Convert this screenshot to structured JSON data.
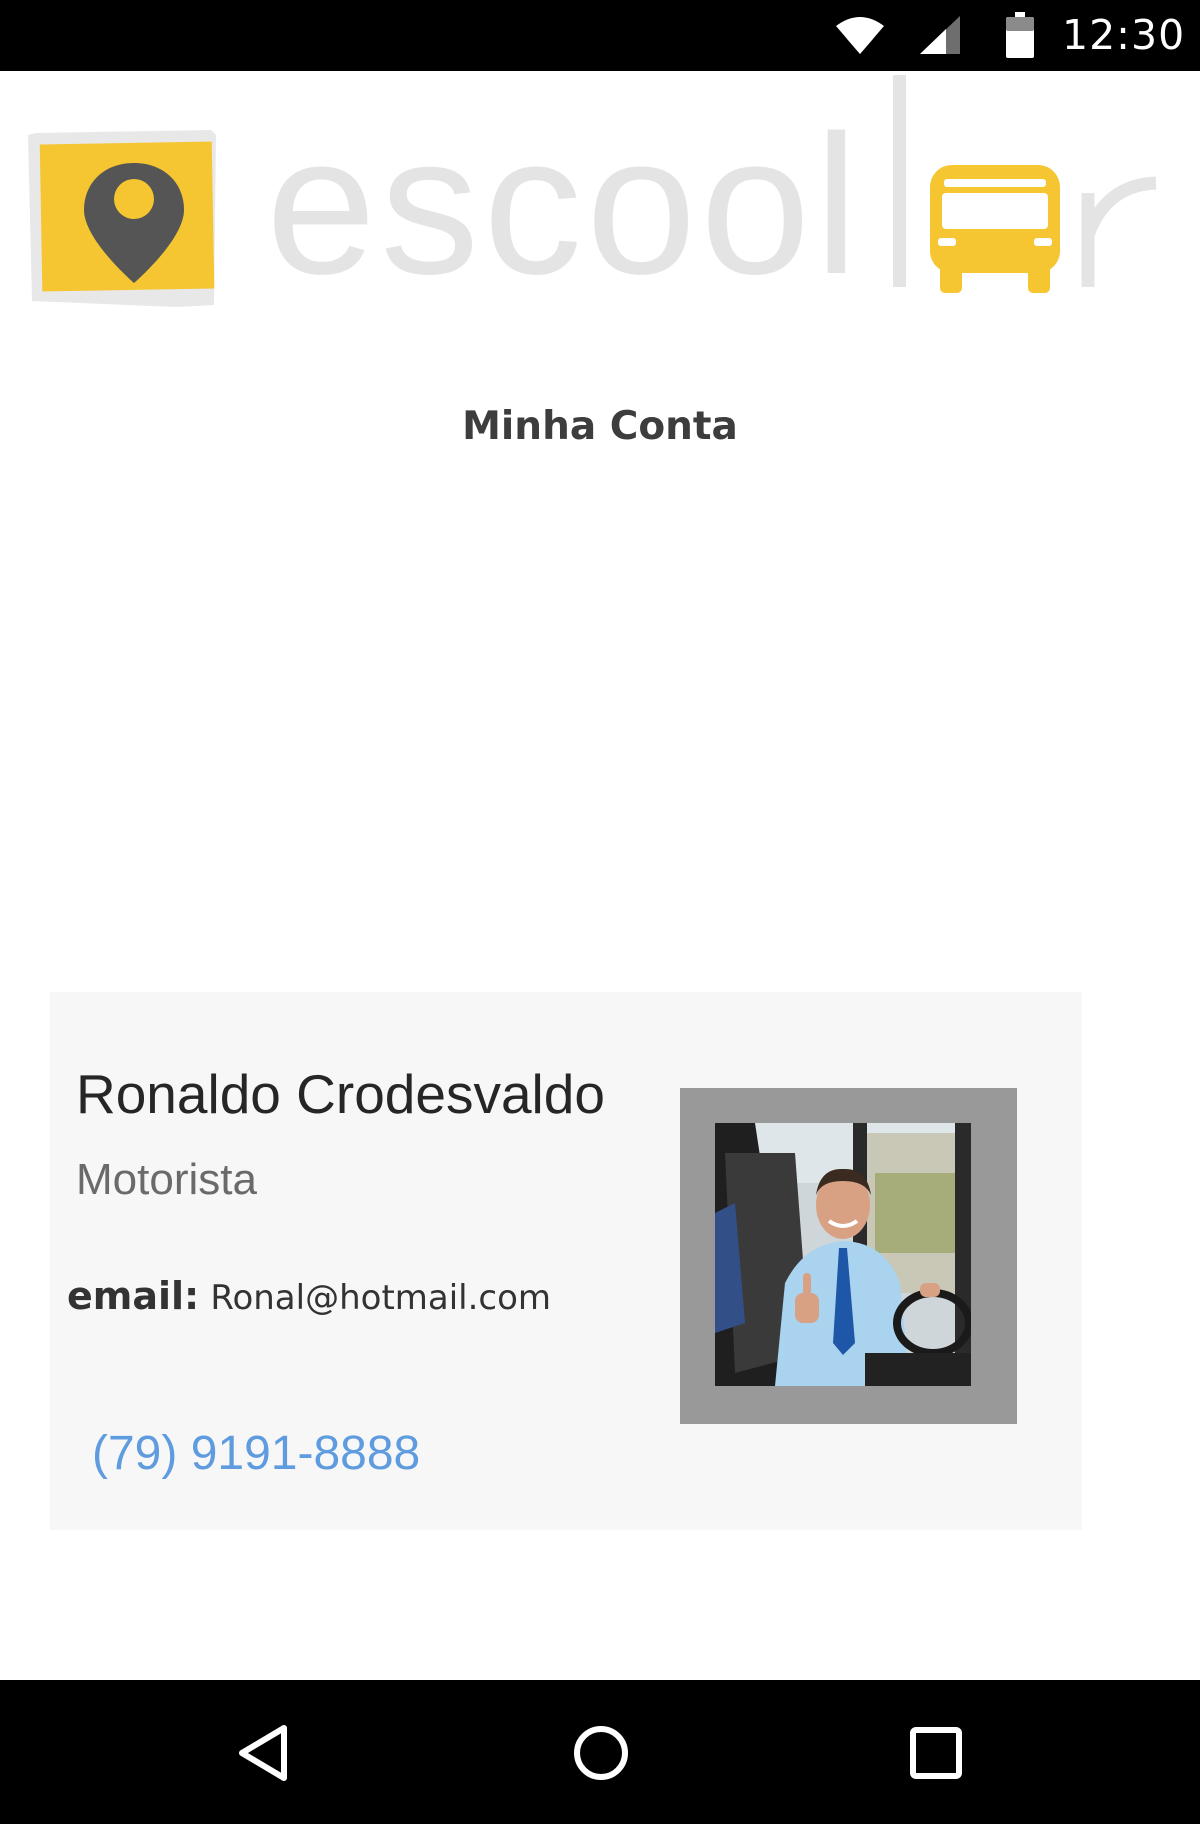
{
  "status_bar": {
    "time": "12:30",
    "icons": [
      "wifi-icon",
      "cell-signal-icon",
      "battery-icon"
    ]
  },
  "logo": {
    "word": "escoolar",
    "colors": {
      "yellow": "#f5c632",
      "pin": "#555555",
      "text": "#e4e4e4"
    }
  },
  "page": {
    "title": "Minha Conta"
  },
  "profile": {
    "name": "Ronaldo Crodesvaldo",
    "role": "Motorista",
    "email_label": "email:",
    "email": "Ronal@hotmail.com",
    "phone": "(79) 9191-8888",
    "photo_alt": "Foto do motorista"
  },
  "nav_bar": {
    "icons": [
      "back-icon",
      "home-icon",
      "recents-icon"
    ]
  },
  "colors": {
    "status_bar": "#000000",
    "card_bg": "#f7f7f7",
    "photo_frame": "#999999",
    "link": "#5f9bdf"
  }
}
